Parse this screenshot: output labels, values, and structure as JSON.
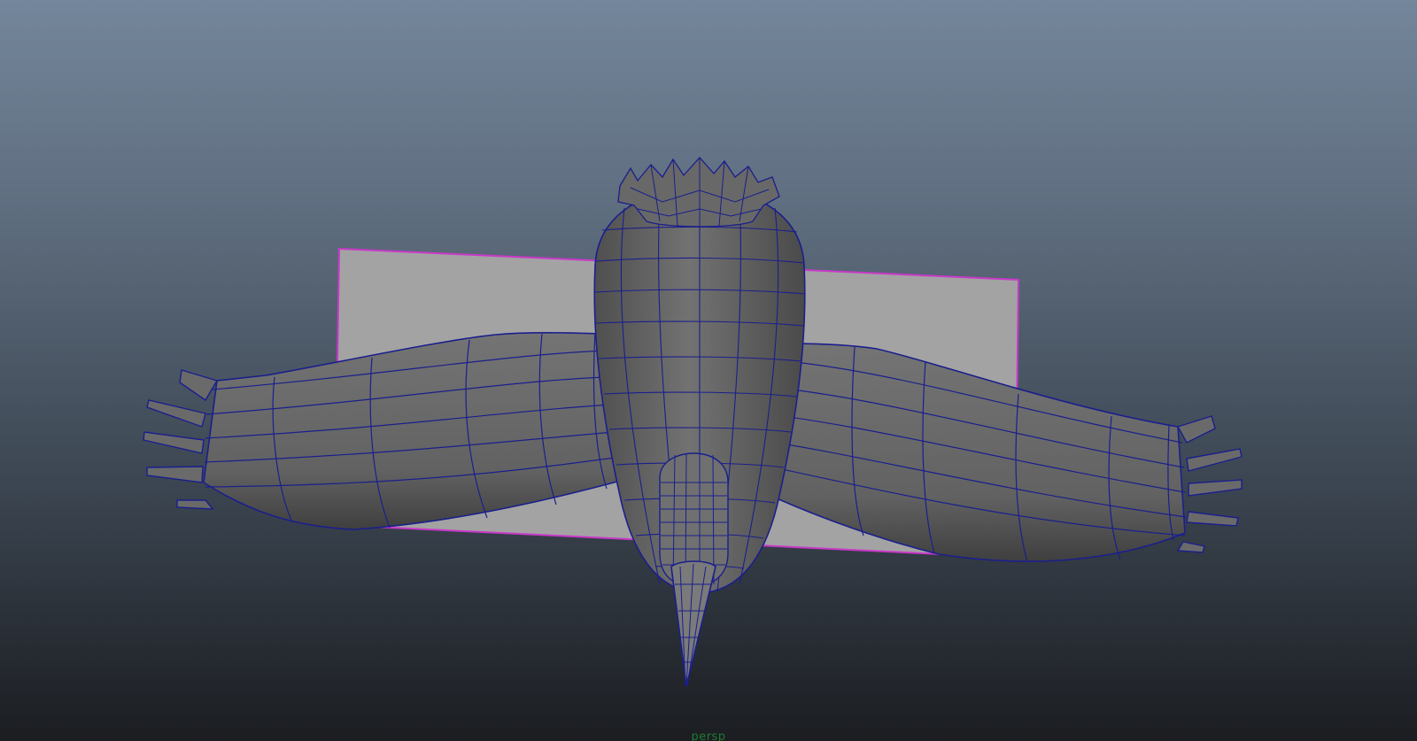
{
  "viewport": {
    "camera_label": "persp",
    "colors": {
      "background_top": "#74869b",
      "background_bottom": "#1b1d21",
      "mesh_fill": "#6a6a6a",
      "wireframe": "#1a1f8c",
      "image_plane_fill": "#a3a3a3",
      "image_plane_outline": "#c839c8",
      "camera_label": "#1f7a34"
    }
  },
  "scene_objects": {
    "image_plane": "image-plane",
    "body": "bird-body",
    "left_wing": "left-wing",
    "right_wing": "right-wing",
    "tail": "tail",
    "beak": "beak",
    "head_crest": "head-crest"
  }
}
